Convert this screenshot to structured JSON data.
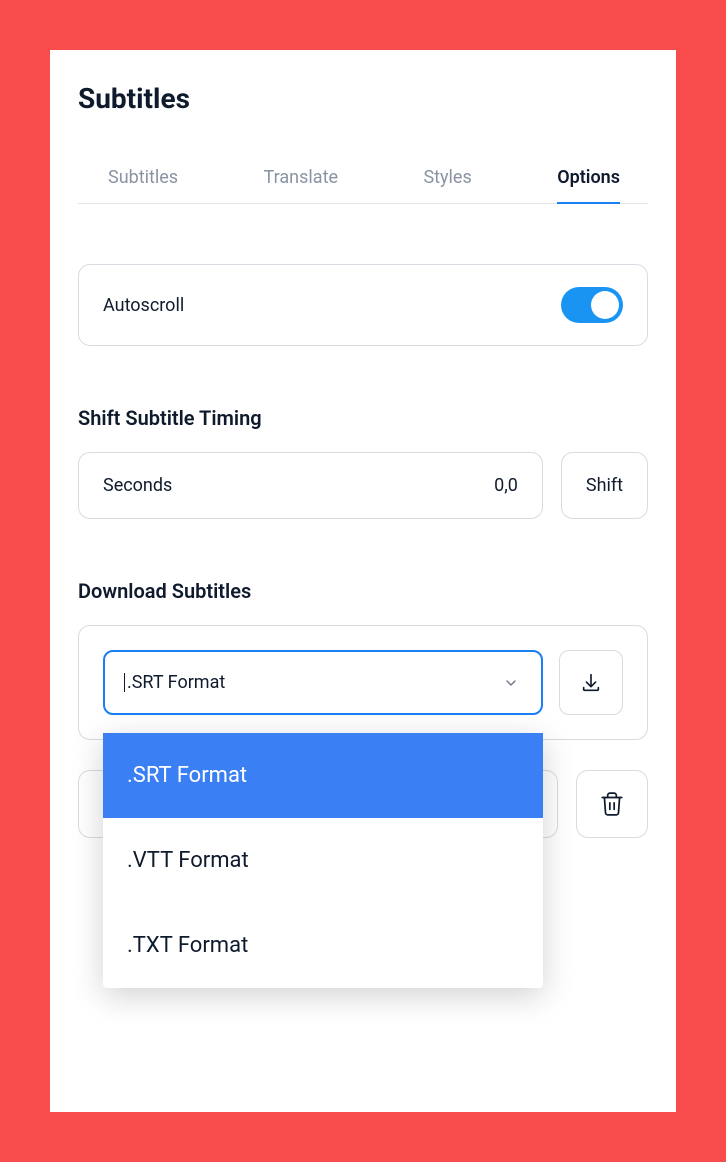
{
  "title": "Subtitles",
  "tabs": {
    "items": [
      {
        "label": "Subtitles"
      },
      {
        "label": "Translate"
      },
      {
        "label": "Styles"
      },
      {
        "label": "Options"
      }
    ]
  },
  "autoscroll": {
    "label": "Autoscroll",
    "enabled": true
  },
  "shift": {
    "heading": "Shift Subtitle Timing",
    "input_label": "Seconds",
    "value": "0,0",
    "button": "Shift"
  },
  "download": {
    "heading": "Download Subtitles",
    "selected": ".SRT Format",
    "options": [
      {
        "label": ".SRT Format"
      },
      {
        "label": ".VTT Format"
      },
      {
        "label": ".TXT Format"
      }
    ]
  }
}
